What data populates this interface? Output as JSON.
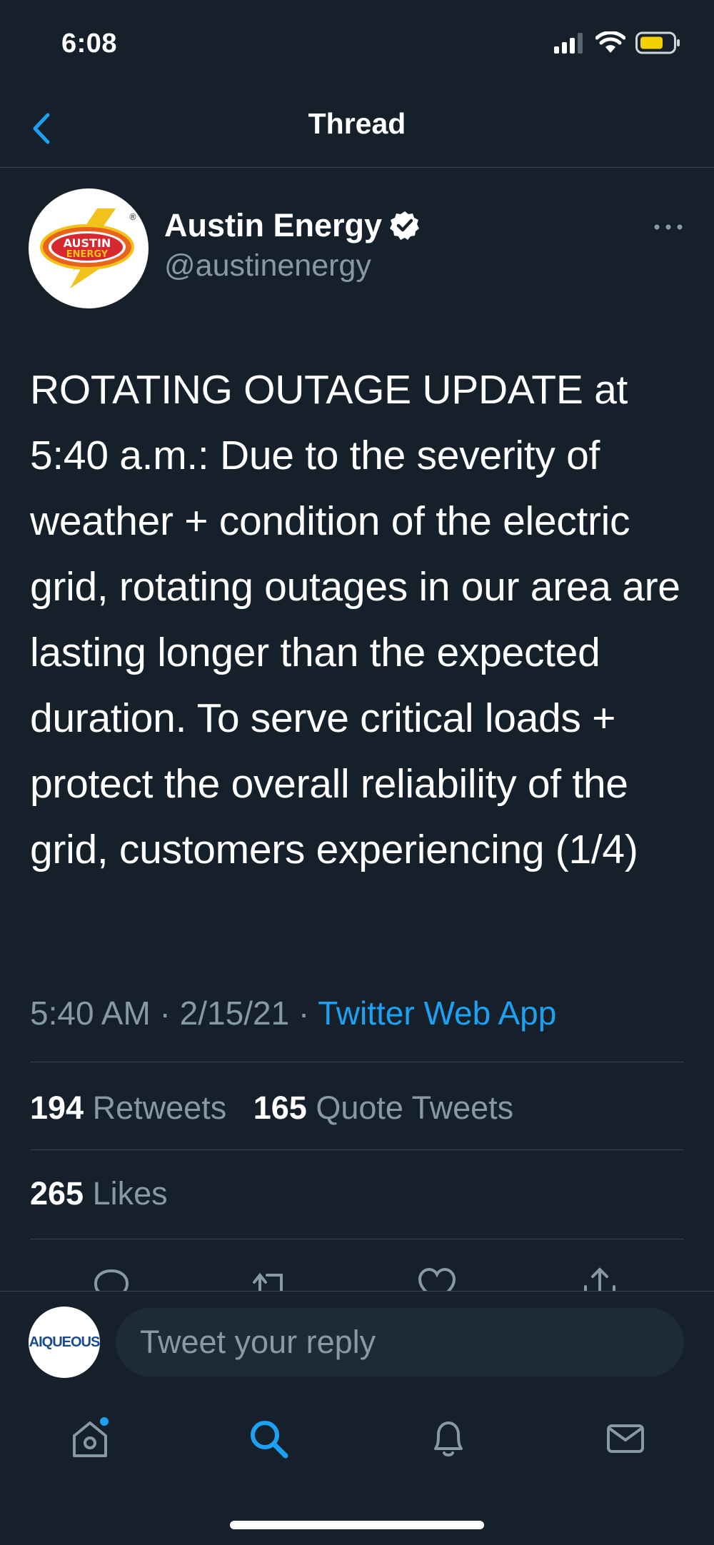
{
  "status_bar": {
    "time": "6:08",
    "battery_color": "#f5d000"
  },
  "header": {
    "title": "Thread"
  },
  "tweet": {
    "author_name": "Austin Energy",
    "handle": "@austinenergy",
    "avatar_logo": {
      "line1": "AUSTIN",
      "line2": "ENERGY"
    },
    "verified": true,
    "text": "ROTATING OUTAGE UPDATE at 5:40 a.m.: Due to the severity of weather + condition of the electric grid, rotating outages in our area are lasting longer than the expected duration. To serve critical loads + protect the overall reliability of the grid, customers experiencing (1/4)",
    "time": "5:40 AM",
    "separator": " · ",
    "date": "2/15/21",
    "source": "Twitter Web App",
    "retweets_count": "194",
    "retweets_label": "Retweets",
    "quote_count": "165",
    "quote_label": "Quote Tweets",
    "likes_count": "265",
    "likes_label": "Likes"
  },
  "reply": {
    "avatar_text": "AIQUEOUS",
    "placeholder": "Tweet your reply"
  },
  "colors": {
    "background": "#15202b",
    "accent": "#1da1f2",
    "secondary_text": "#8899a6",
    "divider": "#38444d"
  },
  "tabs": [
    {
      "name": "home",
      "icon": "home-icon",
      "has_notification_dot": true
    },
    {
      "name": "search",
      "icon": "search-icon",
      "active": true
    },
    {
      "name": "notifications",
      "icon": "bell-icon"
    },
    {
      "name": "messages",
      "icon": "mail-icon"
    }
  ]
}
